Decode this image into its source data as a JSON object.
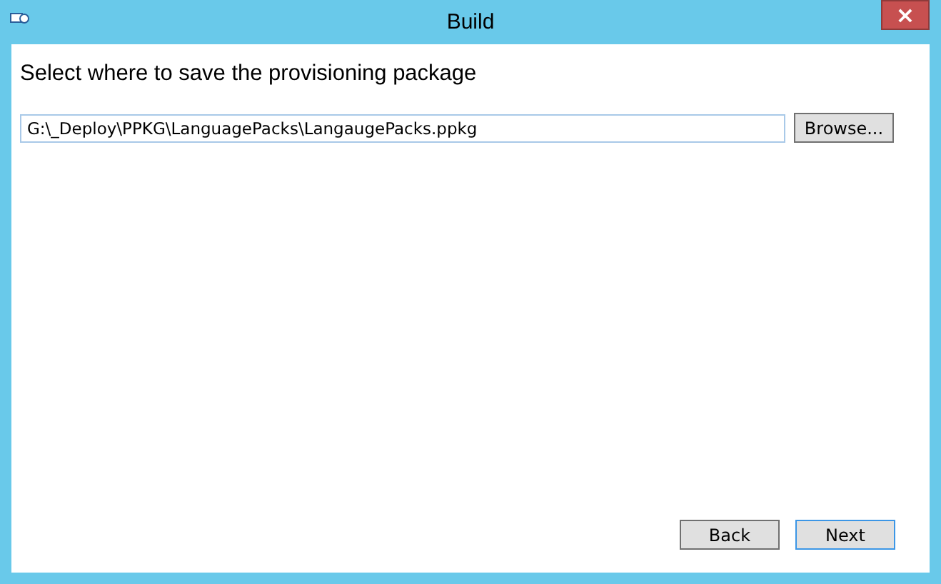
{
  "window": {
    "title": "Build",
    "close": "×"
  },
  "heading": "Select where to save the provisioning package",
  "path_field": {
    "value": "G:\\_Deploy\\PPKG\\LanguagePacks\\LangaugePacks.ppkg"
  },
  "browse_button": "Browse...",
  "buttons": [
    {
      "label": "Back",
      "focused": false
    },
    {
      "label": "Next",
      "focused": true
    }
  ]
}
